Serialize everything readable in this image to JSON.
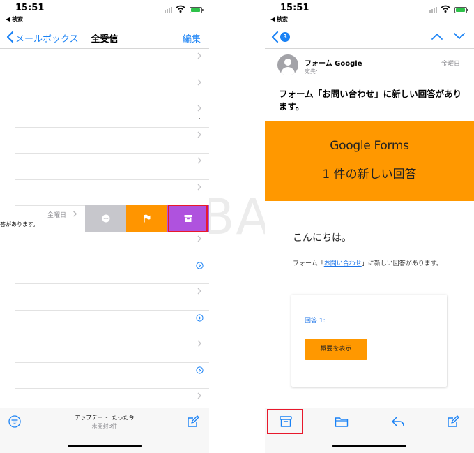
{
  "status": {
    "time": "15:51",
    "back_app": "◀ 検索"
  },
  "left": {
    "nav": {
      "back_label": "メールボックス",
      "title": "全受信",
      "edit_label": "編集"
    },
    "swiped_row": {
      "day": "金曜日",
      "preview": "答があります。"
    },
    "actions": [
      {
        "name": "more",
        "icon": "ellipsis-circle",
        "color": "#c7c7cc"
      },
      {
        "name": "flag",
        "icon": "flag",
        "color": "#ff9500"
      },
      {
        "name": "archive",
        "icon": "archive-box",
        "color": "#af52de"
      }
    ],
    "toolbar": {
      "updated": "アップデート: たった今",
      "unread": "未開封3件"
    },
    "highlight_color": "#e8192c"
  },
  "right": {
    "nav": {
      "badge": "3"
    },
    "header": {
      "sender": "フォーム Google",
      "to": "宛先:",
      "day": "金曜日"
    },
    "subject": "フォーム「お問い合わせ」に新しい回答があります。",
    "banner": {
      "logo_google": "Google",
      "logo_forms": "Forms",
      "headline": "1 件の新しい回答",
      "color": "#ff9800"
    },
    "body": {
      "greeting": "こんにちは。",
      "msg_before": "フォーム「",
      "msg_link": "お問い合わせ",
      "msg_after": "」に新しい回答があります。"
    },
    "card": {
      "response_label": "回答 1:",
      "view_button": "概要を表示"
    },
    "toolbar": [
      "archive",
      "folder",
      "reply",
      "compose"
    ]
  },
  "watermark": "©SBAPP"
}
